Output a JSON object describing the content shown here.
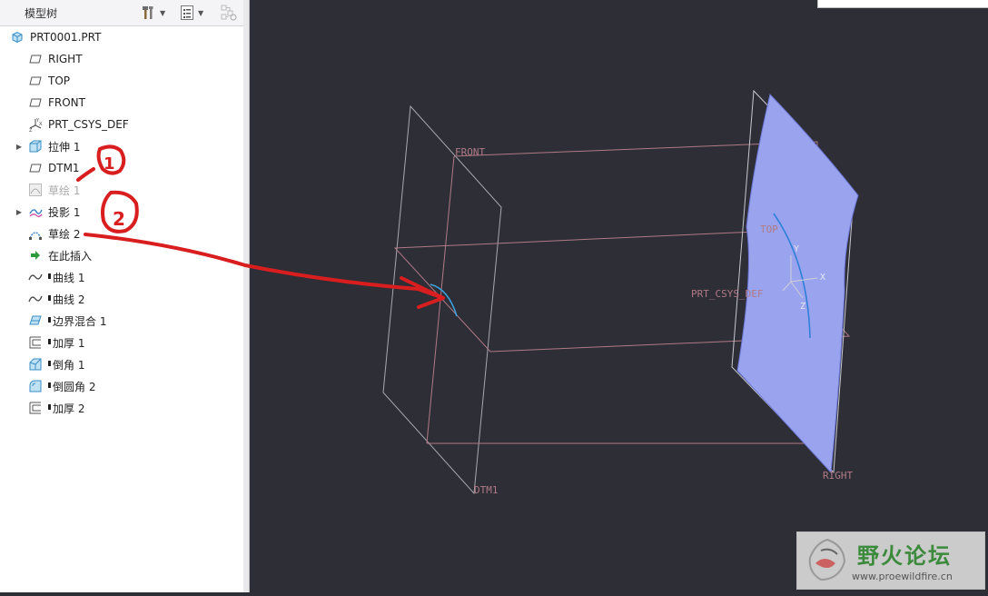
{
  "window": {
    "title": "模型树"
  },
  "toolbar": {
    "tools_icon": "hammer-wrench-icon",
    "list_icon": "tree-list-icon",
    "filter_icon": "filter-icon"
  },
  "tree": {
    "root": {
      "label": "PRT0001.PRT",
      "icon": "part-icon"
    },
    "items": [
      {
        "label": "RIGHT",
        "icon": "datum-plane-icon"
      },
      {
        "label": "TOP",
        "icon": "datum-plane-icon"
      },
      {
        "label": "FRONT",
        "icon": "datum-plane-icon"
      },
      {
        "label": "PRT_CSYS_DEF",
        "icon": "coordinate-system-icon"
      },
      {
        "label": "拉伸 1",
        "icon": "extrude-icon",
        "expandable": true
      },
      {
        "label": "DTM1",
        "icon": "datum-plane-icon"
      },
      {
        "label": "草绘 1",
        "icon": "sketch-icon",
        "suppressed": true
      },
      {
        "label": "投影 1",
        "icon": "projection-icon",
        "expandable": true
      },
      {
        "label": "草绘 2",
        "icon": "sketch-icon"
      },
      {
        "label": "在此插入",
        "icon": "insert-here-arrow-icon"
      },
      {
        "label": "曲线 1",
        "icon": "curve-icon",
        "marked": true
      },
      {
        "label": "曲线 2",
        "icon": "curve-icon",
        "marked": true
      },
      {
        "label": "边界混合 1",
        "icon": "boundary-blend-icon",
        "marked": true
      },
      {
        "label": "加厚 1",
        "icon": "thicken-icon",
        "marked": true
      },
      {
        "label": "倒角 1",
        "icon": "chamfer-icon",
        "marked": true
      },
      {
        "label": "倒圆角 2",
        "icon": "round-icon",
        "marked": true
      },
      {
        "label": "加厚 2",
        "icon": "thicken-icon",
        "marked": true
      }
    ]
  },
  "viewport": {
    "background": "#2e2e36",
    "datum_labels": {
      "front": "FRONT",
      "top": "TOP",
      "csys": "PRT_CSYS_DEF",
      "right": "RIGHT",
      "dtm1": "DTM1",
      "axis_x": "X",
      "axis_y": "Y",
      "axis_z": "Z"
    },
    "annotations": {
      "one": "1",
      "two": "2"
    },
    "colors": {
      "datum_plane": "#a8a8b0",
      "datum_label": "#b07a86",
      "surface": "#9aa3ee",
      "curve": "#2f7fd9",
      "annotation": "#d81e1e"
    }
  },
  "watermark": {
    "title": "野火论坛",
    "url": "www.proewildfire.cn"
  }
}
